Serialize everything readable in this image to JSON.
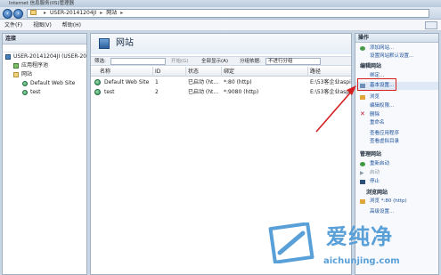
{
  "window": {
    "title": "Internet 信息服务(IIS)管理器"
  },
  "address": {
    "segments": [
      "USER-20141204JI",
      "网站"
    ]
  },
  "menu": {
    "items": [
      "文件(F)",
      "视图(V)",
      "帮助(H)"
    ]
  },
  "connections": {
    "title": "连接",
    "tree": [
      {
        "label": "USER-20141204JI (USER-20",
        "level": 0,
        "icon": "computer-icon"
      },
      {
        "label": "应用程序池",
        "level": 1,
        "icon": "app-pool-icon"
      },
      {
        "label": "网站",
        "level": 1,
        "icon": "folder-icon"
      },
      {
        "label": "Default Web Site",
        "level": 2,
        "icon": "globe-icon"
      },
      {
        "label": "test",
        "level": 2,
        "icon": "globe-icon"
      }
    ]
  },
  "main": {
    "title": "网站",
    "filter": {
      "label": "筛选:",
      "go_label": "开始(G)",
      "show_all_label": "全部显示(A)",
      "group_label": "分组依据:",
      "group_value": "不进行分组"
    },
    "columns": [
      "名称",
      "ID",
      "状态",
      "绑定",
      "路径"
    ],
    "rows": [
      {
        "name": "Default Web Site",
        "id": "1",
        "status": "已启动 (ht...",
        "binding": "*:80 (http)",
        "path": "E:\\53客企业aspi"
      },
      {
        "name": "test",
        "id": "2",
        "status": "已启动 (ht...",
        "binding": "*:9080 (http)",
        "path": "E:\\53客企业aspi"
      }
    ]
  },
  "actions": {
    "title": "操作",
    "top": [
      {
        "label": "添加网站...",
        "icon": "add-site-icon"
      },
      {
        "label": "设置网站默认设置...",
        "icon": ""
      }
    ],
    "edit_section": "编辑网站",
    "edit": [
      {
        "label": "绑定...",
        "icon": ""
      },
      {
        "label": "基本设置...",
        "icon": "settings-icon",
        "highlight": true
      },
      {
        "label": "浏览",
        "icon": "browse-icon"
      },
      {
        "label": "编辑权限...",
        "icon": ""
      },
      {
        "label": "删除",
        "icon": "delete-icon"
      },
      {
        "label": "重命名",
        "icon": ""
      },
      {
        "label": "查看应用程序",
        "icon": ""
      },
      {
        "label": "查看虚拟目录",
        "icon": ""
      }
    ],
    "manage_section": "管理网站",
    "manage": [
      {
        "label": "重新启动",
        "icon": "restart-icon"
      },
      {
        "label": "启动",
        "icon": "start-icon"
      },
      {
        "label": "停止",
        "icon": "stop-icon"
      }
    ],
    "browse_section": "浏览网站",
    "browse": [
      {
        "label": "浏览 *:80 (http)",
        "icon": "browse-icon"
      }
    ],
    "advanced": [
      {
        "label": "高级设置...",
        "icon": ""
      }
    ]
  },
  "watermark": {
    "brand": "爱纯净",
    "url": "aichunjing.com"
  },
  "colors": {
    "link": "#1b4f9a",
    "annotation_red": "#d42020",
    "watermark": "#5aa0d8"
  }
}
